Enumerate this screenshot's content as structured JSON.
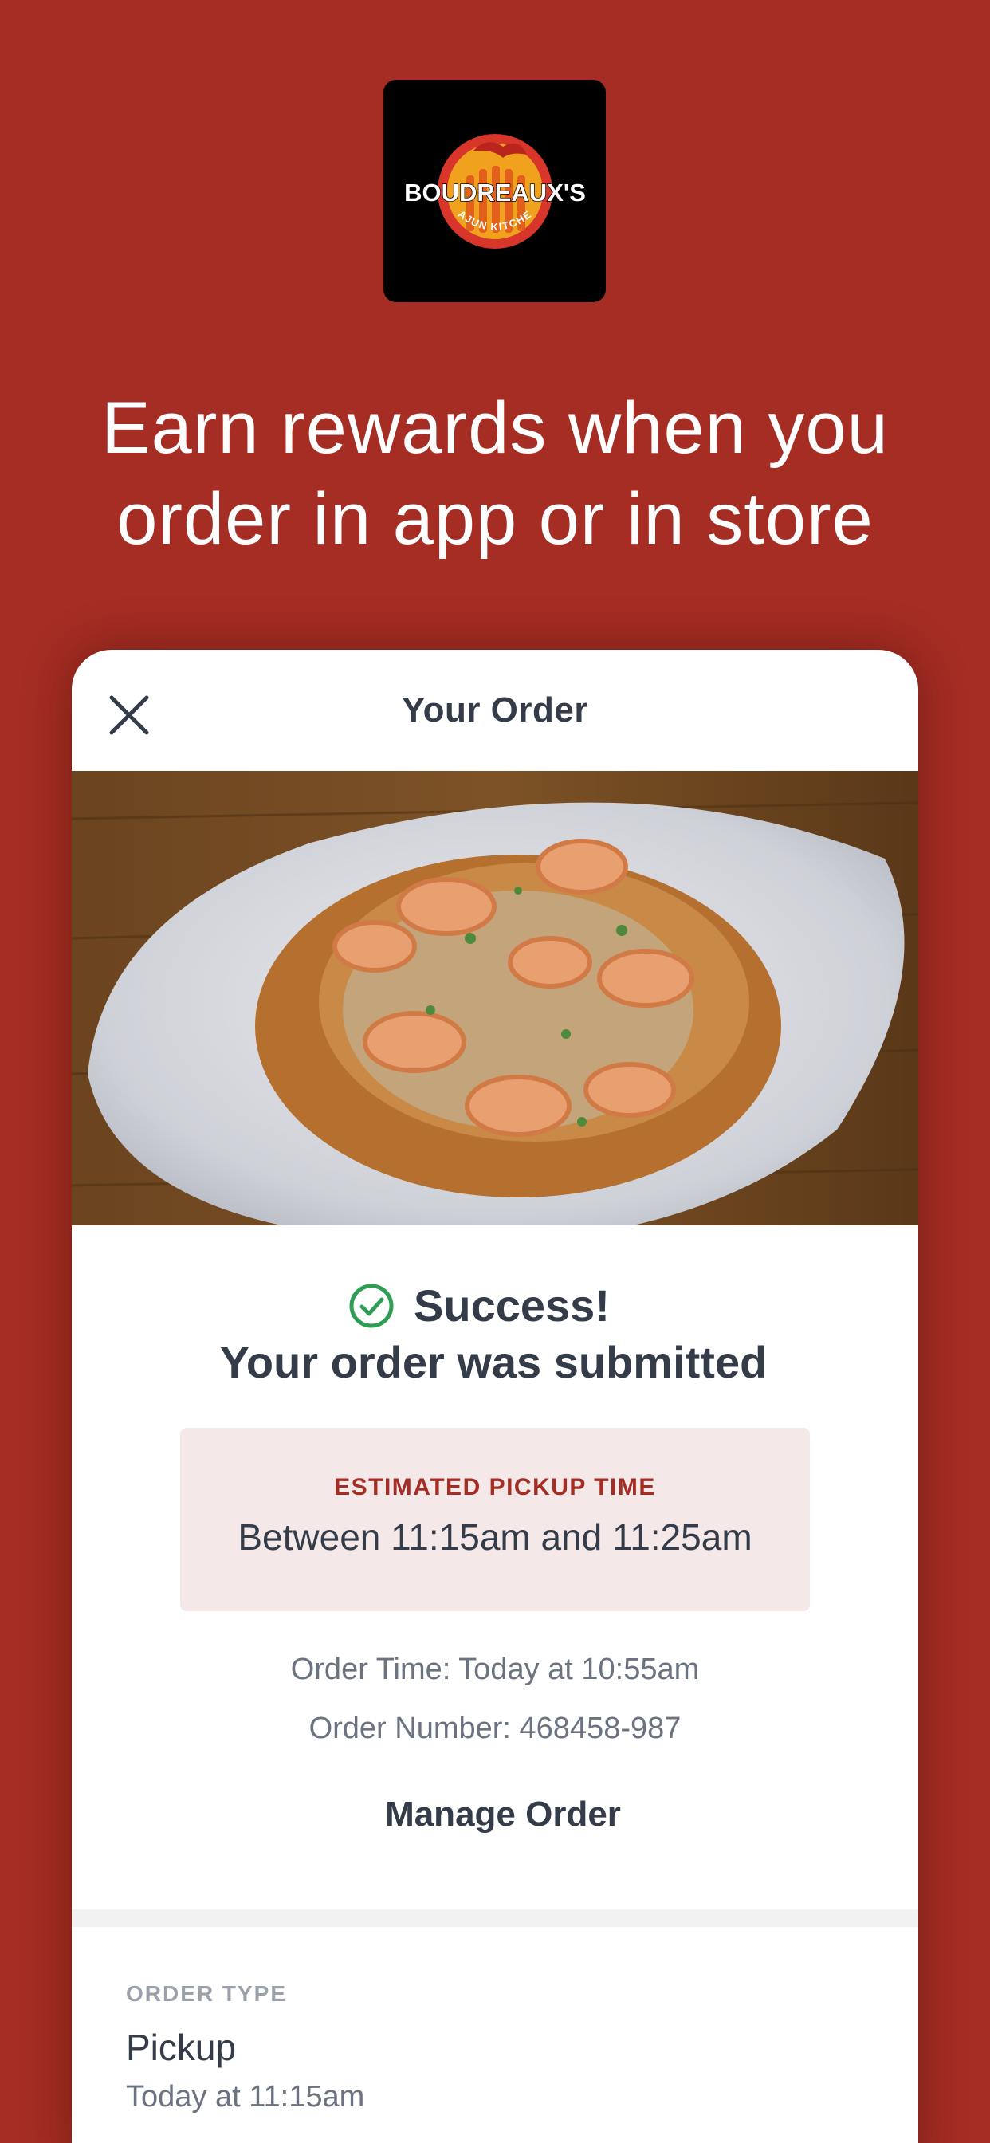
{
  "brand": {
    "logo_text": "BOUDREAUX'S",
    "logo_subtext": "CAJUN KITCHEN"
  },
  "hero": {
    "line1": "Earn rewards when you",
    "line2": "order in app or in store"
  },
  "order_card": {
    "title": "Your Order",
    "success_title": "Success!",
    "success_subtitle": "Your order was submitted",
    "eta_label": "ESTIMATED PICKUP TIME",
    "eta_value": "Between 11:15am and 11:25am",
    "order_time": "Order Time: Today at 10:55am",
    "order_number": "Order Number: 468458-987",
    "manage_label": "Manage Order",
    "order_type_label": "ORDER TYPE",
    "order_type_value": "Pickup",
    "order_type_time": "Today at 11:15am"
  },
  "colors": {
    "background": "#a52d24",
    "success_green": "#2e9e55",
    "eta_box": "#f5e8e8",
    "text_dark": "#333c48"
  },
  "icons": [
    "close-icon",
    "check-circle-icon"
  ]
}
